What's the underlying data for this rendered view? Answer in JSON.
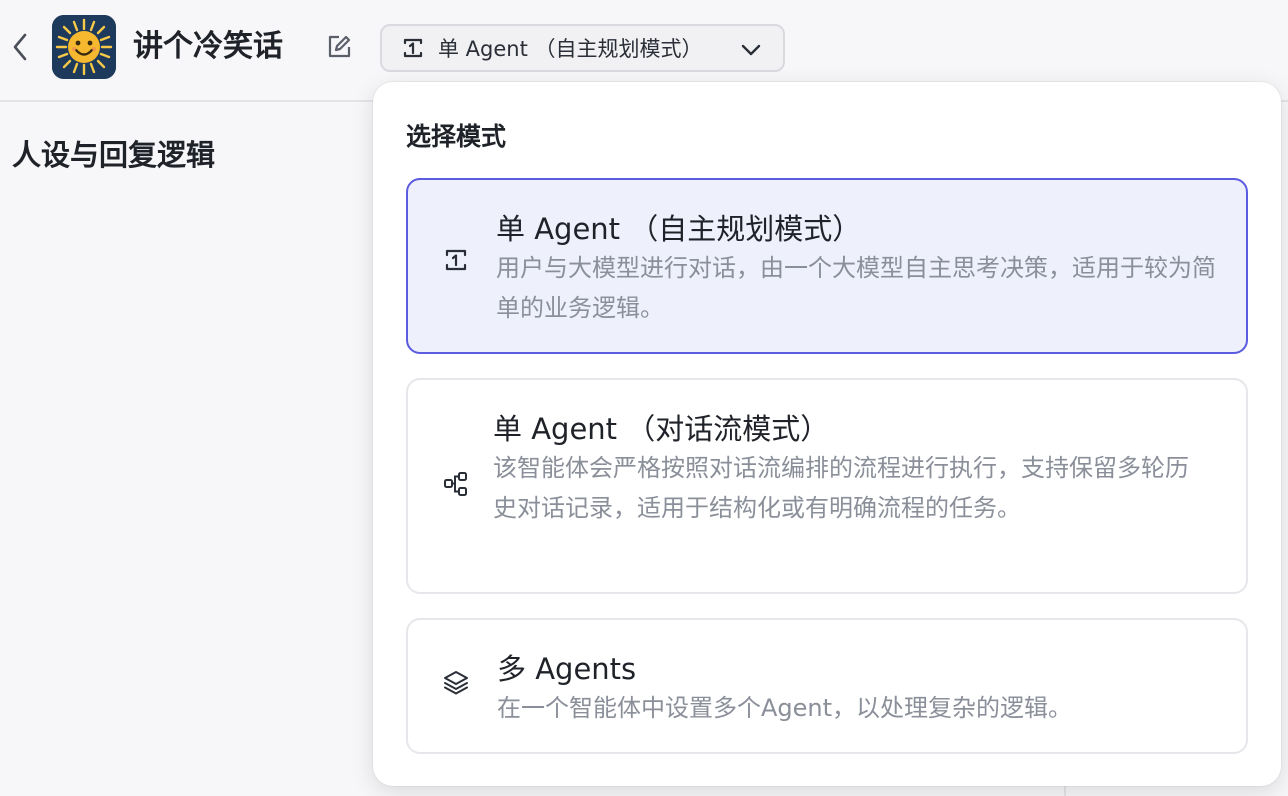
{
  "header": {
    "bot_name": "讲个冷笑话",
    "mode_selected_label": "单 Agent （自主规划模式）"
  },
  "main": {
    "section_title": "人设与回复逻辑"
  },
  "mode_panel": {
    "title": "选择模式",
    "options": [
      {
        "title": "单 Agent （自主规划模式）",
        "description": "用户与大模型进行对话，由一个大模型自主思考决策，适用于较为简单的业务逻辑。",
        "icon": "single-agent-icon",
        "selected": true
      },
      {
        "title": "单 Agent （对话流模式）",
        "description": "该智能体会严格按照对话流编排的流程进行执行，支持保留多轮历史对话记录，适用于结构化或有明确流程的任务。",
        "icon": "workflow-icon",
        "selected": false
      },
      {
        "title": "多 Agents",
        "description": "在一个智能体中设置多个Agent，以处理复杂的逻辑。",
        "icon": "layers-icon",
        "selected": false
      }
    ]
  },
  "colors": {
    "accent": "#5b5ce0",
    "selected_bg": "#eef0fc",
    "muted_text": "#8a8f99"
  }
}
